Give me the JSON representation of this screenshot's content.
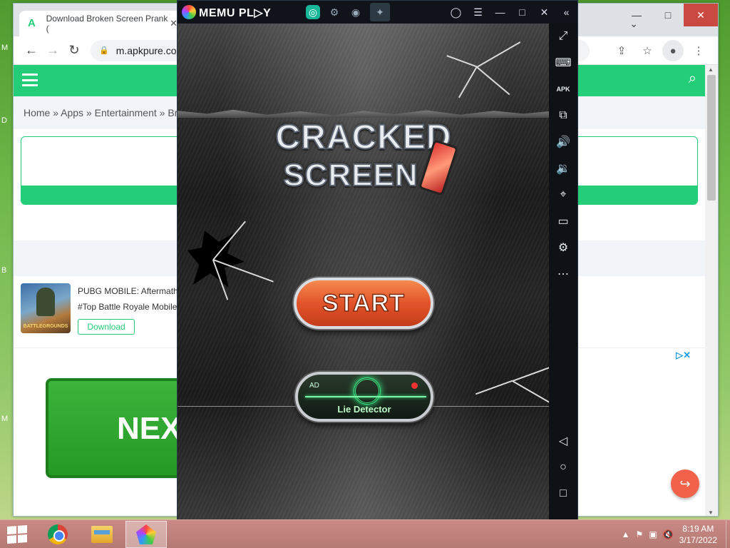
{
  "browser": {
    "tab_title": "Download Broken Screen Prank (",
    "tab_favicon_letter": "A",
    "url": "m.apkpure.com",
    "window_controls": {
      "minimize": "—",
      "maximize": "□",
      "close": "✕"
    }
  },
  "site": {
    "breadcrumb": "Home » Apps » Entertainment » Br",
    "promo": {
      "title": "PUBG MOBILE: Aftermath",
      "tag": "#Top Battle Royale Mobile",
      "download_label": "Download",
      "thumb_label": "BATTLEGROUNDS"
    },
    "ad_button_text": "NEX",
    "ad_icons": "▷✕"
  },
  "memu": {
    "brand": "MEMU PL▷Y",
    "sidebar_icons": [
      "⤢",
      "⌨",
      "APK",
      "⧉",
      "🔊",
      "🔉",
      "⌖",
      "▭",
      "⚙",
      "⋯",
      "◁",
      "○",
      "□"
    ]
  },
  "game": {
    "title_line1": "CRACKED",
    "title_line2": "SCREEN",
    "start_label": "START",
    "ad_badge": "AD",
    "lie_detector_label": "Lie Detector"
  },
  "taskbar": {
    "time": "8:19 AM",
    "date": "3/17/2022"
  }
}
